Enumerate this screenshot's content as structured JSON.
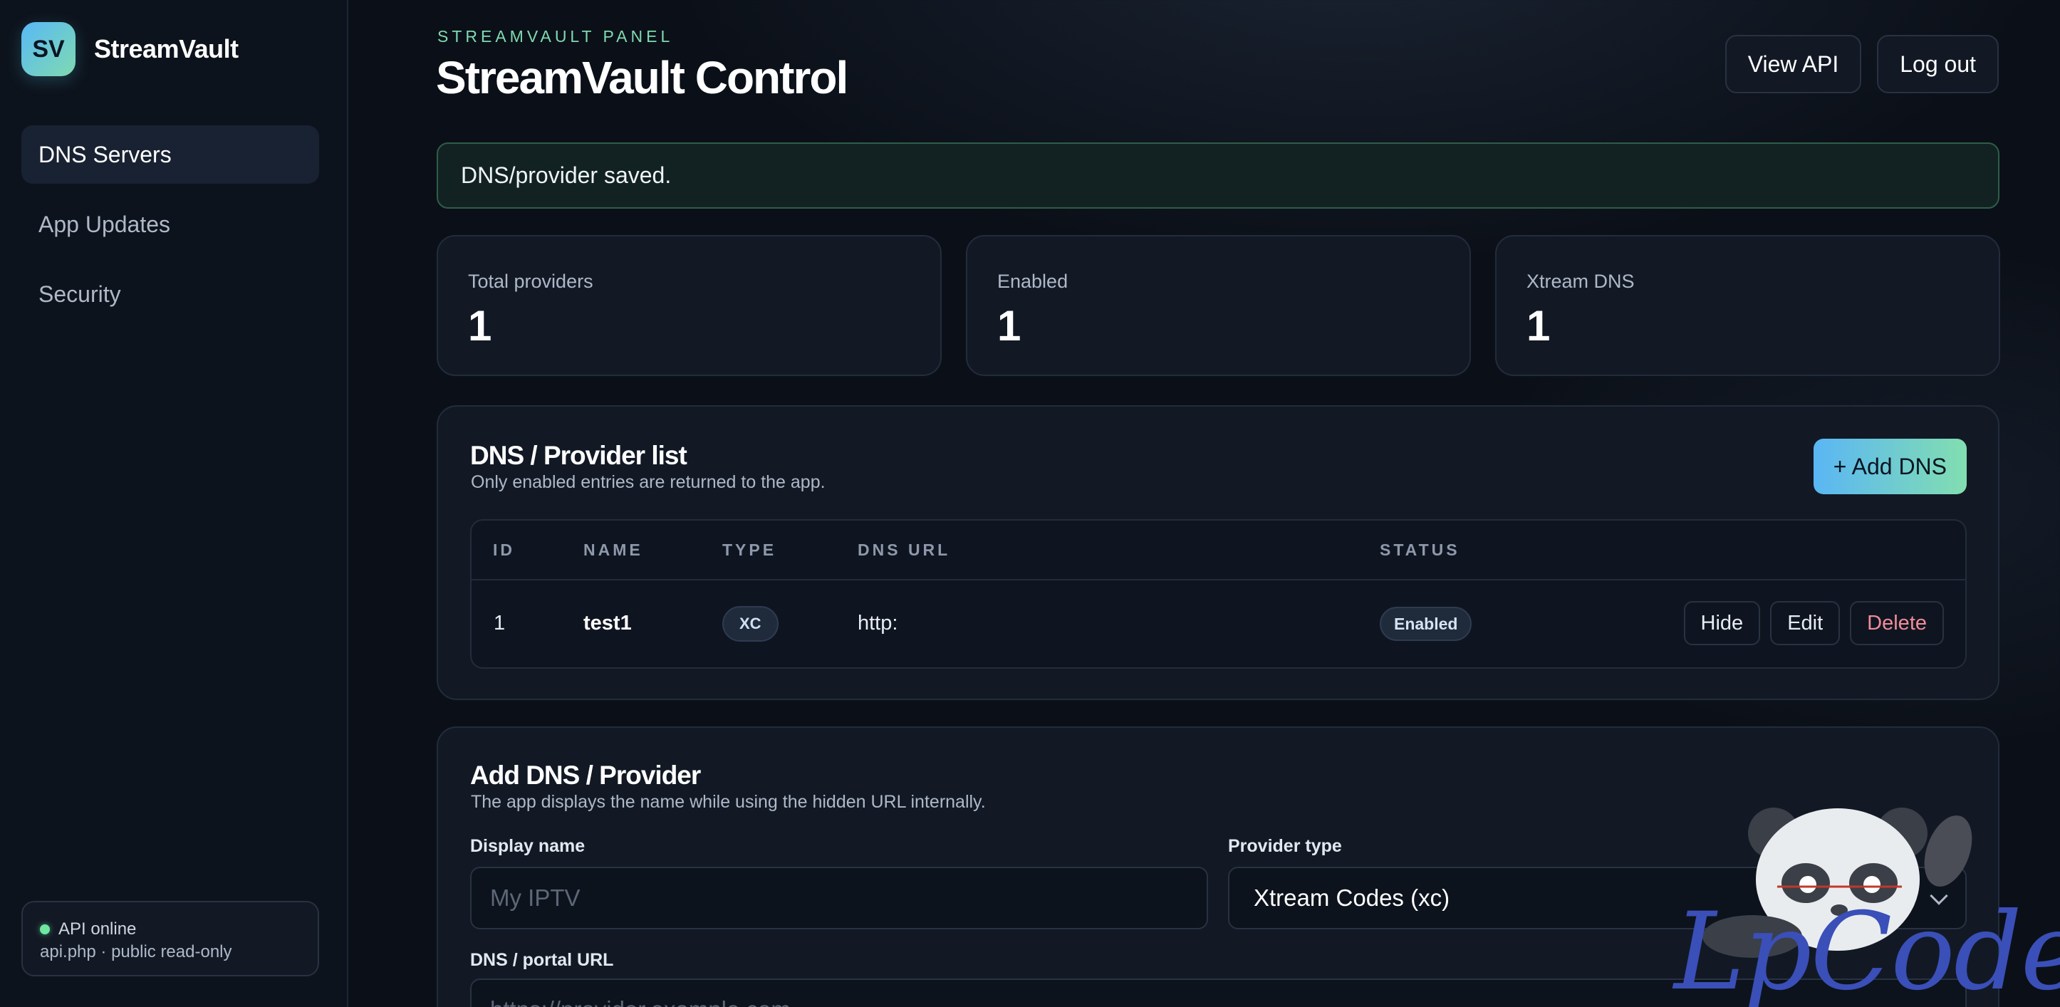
{
  "brand": {
    "logo_text": "SV",
    "name": "StreamVault"
  },
  "sidebar": {
    "items": [
      {
        "label": "DNS Servers",
        "active": true
      },
      {
        "label": "App Updates",
        "active": false
      },
      {
        "label": "Security",
        "active": false
      }
    ],
    "api_status": {
      "title": "API online",
      "detail": "api.php · public read-only"
    }
  },
  "header": {
    "eyebrow": "STREAMVAULT PANEL",
    "title": "StreamVault Control",
    "view_api": "View API",
    "logout": "Log out"
  },
  "alert": {
    "message": "DNS/provider saved."
  },
  "stats": [
    {
      "label": "Total providers",
      "value": "1"
    },
    {
      "label": "Enabled",
      "value": "1"
    },
    {
      "label": "Xtream DNS",
      "value": "1"
    }
  ],
  "provider_list": {
    "title": "DNS / Provider list",
    "subtitle": "Only enabled entries are returned to the app.",
    "add_button": "+ Add DNS",
    "columns": [
      "ID",
      "NAME",
      "TYPE",
      "DNS URL",
      "STATUS"
    ],
    "rows": [
      {
        "id": "1",
        "name": "test1",
        "type": "XC",
        "dns_url": "http:",
        "status": "Enabled",
        "actions": {
          "hide": "Hide",
          "edit": "Edit",
          "delete": "Delete"
        }
      }
    ]
  },
  "add_form": {
    "title": "Add DNS / Provider",
    "subtitle": "The app displays the name while using the hidden URL internally.",
    "display_name_label": "Display name",
    "display_name_placeholder": "My IPTV",
    "provider_type_label": "Provider type",
    "provider_type_value": "Xtream Codes (xc)",
    "dns_url_label": "DNS / portal URL",
    "dns_url_placeholder": "https://provider.example.com"
  },
  "watermark": {
    "text": "LpCodes"
  },
  "colors": {
    "accent_green": "#7fdab0",
    "accent_blue": "#5ab6f4",
    "danger": "#f08c9a",
    "status_online": "#6ee7a0"
  }
}
